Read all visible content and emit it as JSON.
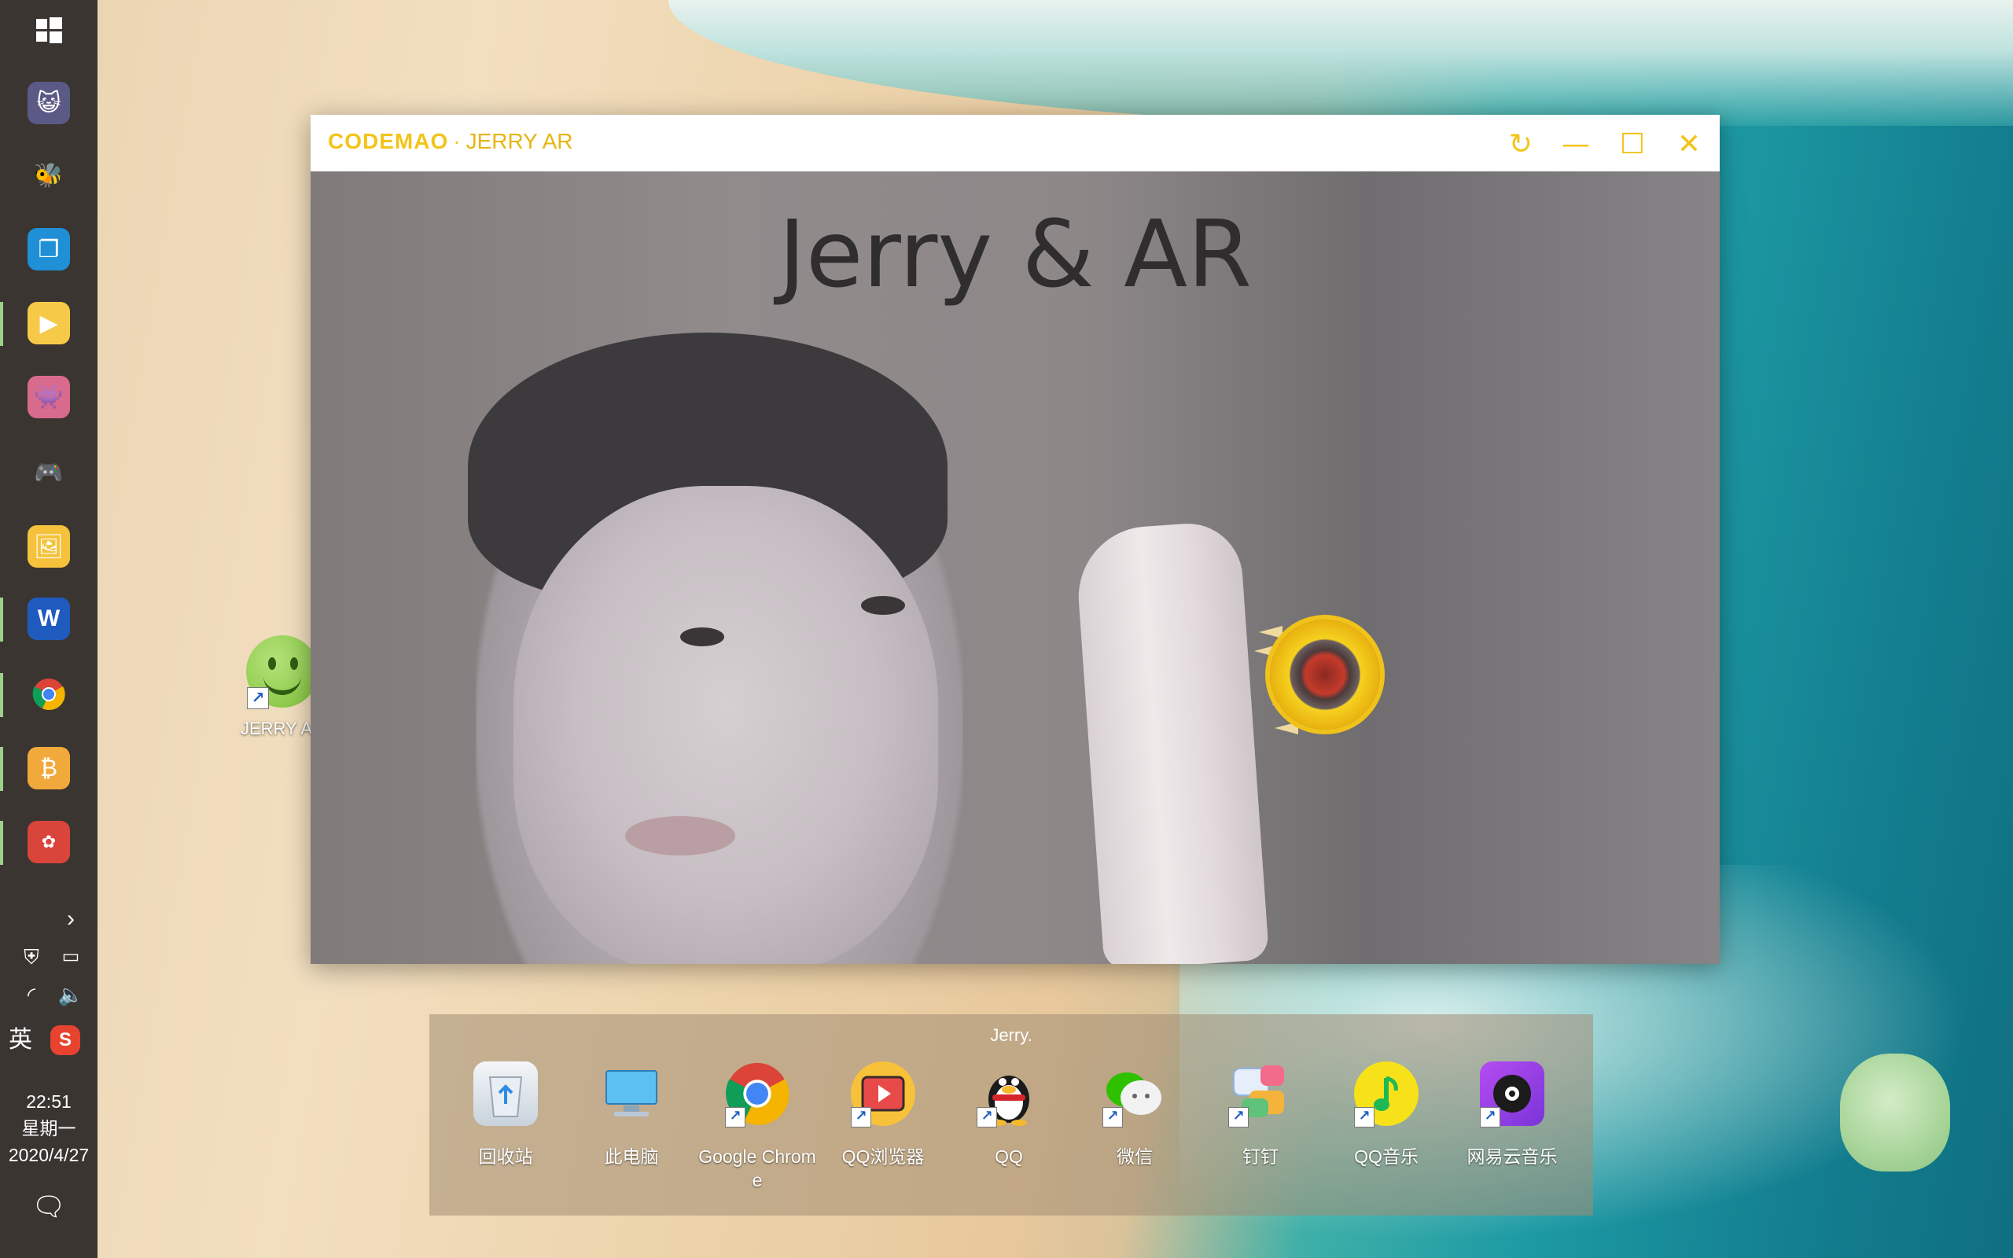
{
  "window": {
    "brand": "CODEMAO",
    "separator": "·",
    "app_title": "JERRY AR",
    "content_title": "Jerry & AR",
    "buttons": {
      "refresh": "↻",
      "minimize": "—",
      "maximize": "☐",
      "close": "✕"
    }
  },
  "desktop_icon": {
    "label": "JERRY AR"
  },
  "dock": {
    "title": "Jerry.",
    "items": [
      {
        "label": "回收站",
        "icon": "recycle-bin-icon"
      },
      {
        "label": "此电脑",
        "icon": "computer-icon"
      },
      {
        "label": "Google Chrome",
        "icon": "chrome-icon"
      },
      {
        "label": "QQ浏览器",
        "icon": "qq-browser-icon"
      },
      {
        "label": "QQ",
        "icon": "qq-penguin-icon"
      },
      {
        "label": "微信",
        "icon": "wechat-icon"
      },
      {
        "label": "钉钉",
        "icon": "dingtalk-icon"
      },
      {
        "label": "QQ音乐",
        "icon": "qq-music-icon"
      },
      {
        "label": "网易云音乐",
        "icon": "netease-music-icon"
      }
    ]
  },
  "taskbar": {
    "ime": "英",
    "time": "22:51",
    "weekday": "星期一",
    "date": "2020/4/27"
  }
}
